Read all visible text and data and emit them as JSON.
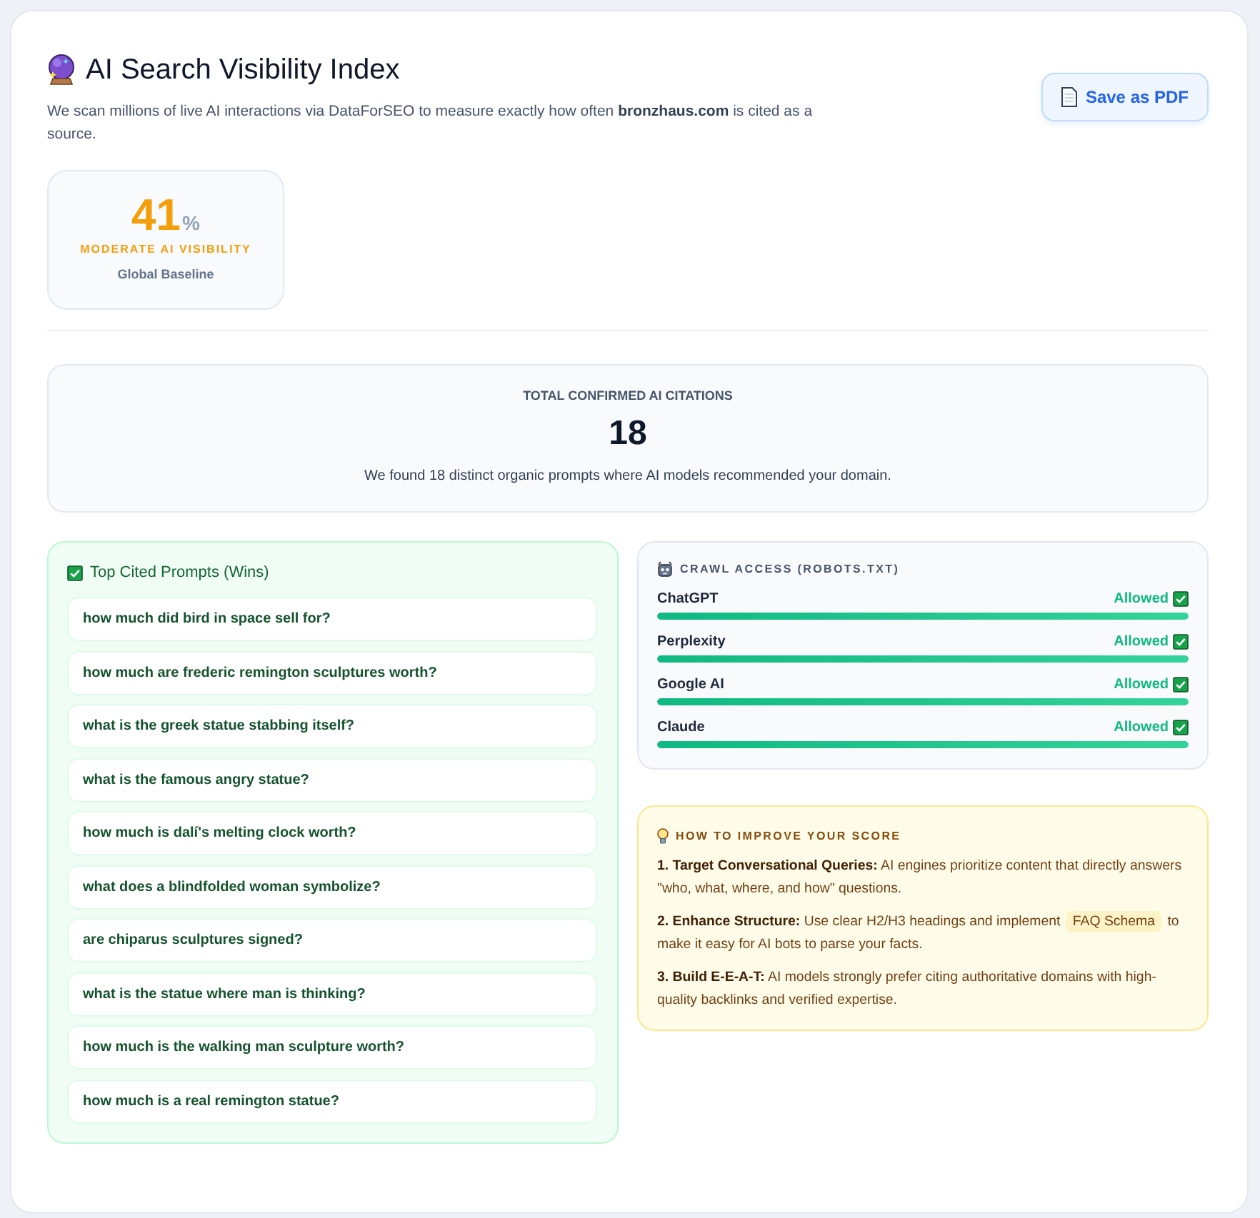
{
  "header": {
    "title": "AI Search Visibility Index",
    "subtitle": "We scan millions of live AI interactions via DataForSEO to measure exactly how often **bronzhaus.com** is cited as a source.",
    "button": "Save as PDF"
  },
  "score": {
    "value": "41",
    "unit": "%",
    "label": "MODERATE AI VISIBILITY",
    "caption": "Global Baseline"
  },
  "citations": {
    "label": "TOTAL CONFIRMED AI CITATIONS",
    "count": "18",
    "description": "We found 18 distinct organic prompts where AI models recommended your domain."
  },
  "prompts": {
    "title": "Top Cited Prompts (Wins)",
    "items": [
      "how much did bird in space sell for?",
      "how much are frederic remington sculptures worth?",
      "what is the greek statue stabbing itself?",
      "what is the famous angry statue?",
      "how much is dalí's melting clock worth?",
      "what does a blindfolded woman symbolize?",
      "are chiparus sculptures signed?",
      "what is the statue where man is thinking?",
      "how much is the walking man sculpture worth?",
      "how much is a real remington statue?"
    ]
  },
  "crawl": {
    "title": "CRAWL ACCESS (ROBOTS.TXT)",
    "rows": [
      {
        "name": "ChatGPT",
        "status": "Allowed",
        "allowed": true,
        "level": 1
      },
      {
        "name": "Perplexity",
        "status": "Allowed",
        "allowed": true,
        "level": 1
      },
      {
        "name": "Google AI",
        "status": "Allowed",
        "allowed": true,
        "level": 1
      },
      {
        "name": "Claude",
        "status": "Allowed",
        "allowed": true,
        "level": 1
      }
    ]
  },
  "tips": {
    "title": "HOW TO IMPROVE YOUR SCORE",
    "items": [
      {
        "title": "1. Target Conversational Queries:",
        "text": "AI engines prioritize content that directly answers \"who, what, where, and how\" questions."
      },
      {
        "title": "2. Enhance Structure:",
        "text": "Use clear H2/H3 headings and implement",
        "code": "FAQ Schema",
        "text_after": "to make it easy for AI bots to parse your facts."
      },
      {
        "title": "3. Build E-E-A-T:",
        "text": "AI models strongly prefer citing authoritative domains with high-quality backlinks and verified expertise."
      }
    ]
  }
}
